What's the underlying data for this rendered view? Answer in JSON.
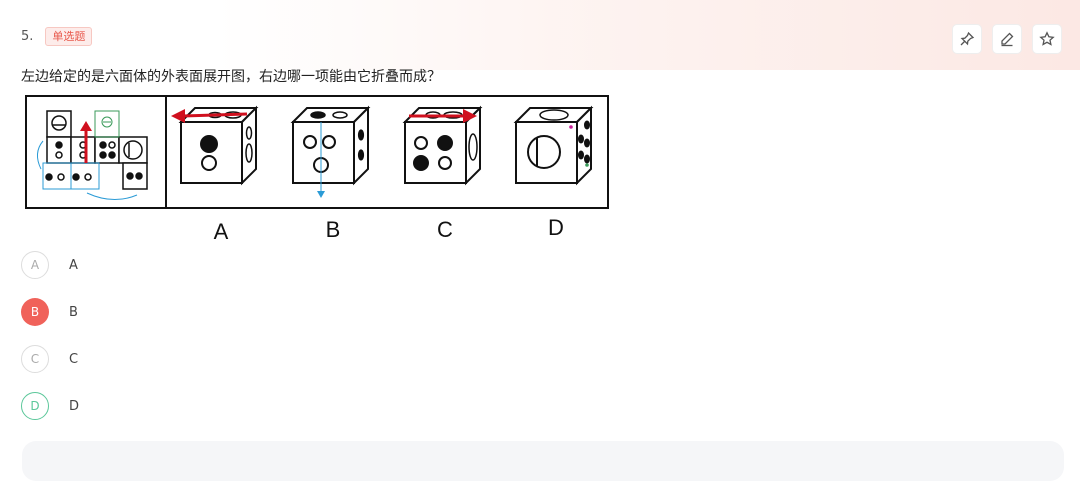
{
  "question": {
    "number": "5.",
    "type_badge": "单选题",
    "stem": "左边给定的是六面体的外表面展开图，右边哪一项能由它折叠而成？"
  },
  "toolbar": {
    "icons": [
      "pin-icon",
      "pencil-icon",
      "star-icon"
    ]
  },
  "figure": {
    "option_letters": [
      "A",
      "B",
      "C",
      "D"
    ],
    "colors": {
      "arrow_red": "#d0101e",
      "annotation_blue": "#2b9bd6",
      "annotation_green": "#3a9a5a",
      "annotation_magenta": "#c8209a"
    }
  },
  "options": [
    {
      "letter": "A",
      "label": "A",
      "state": "default"
    },
    {
      "letter": "B",
      "label": "B",
      "state": "wrong-selected"
    },
    {
      "letter": "C",
      "label": "C",
      "state": "default"
    },
    {
      "letter": "D",
      "label": "D",
      "state": "correct"
    }
  ],
  "colors": {
    "accent_red": "#f0625a",
    "correct_green": "#5bc79a",
    "badge_text": "#e8594c"
  }
}
